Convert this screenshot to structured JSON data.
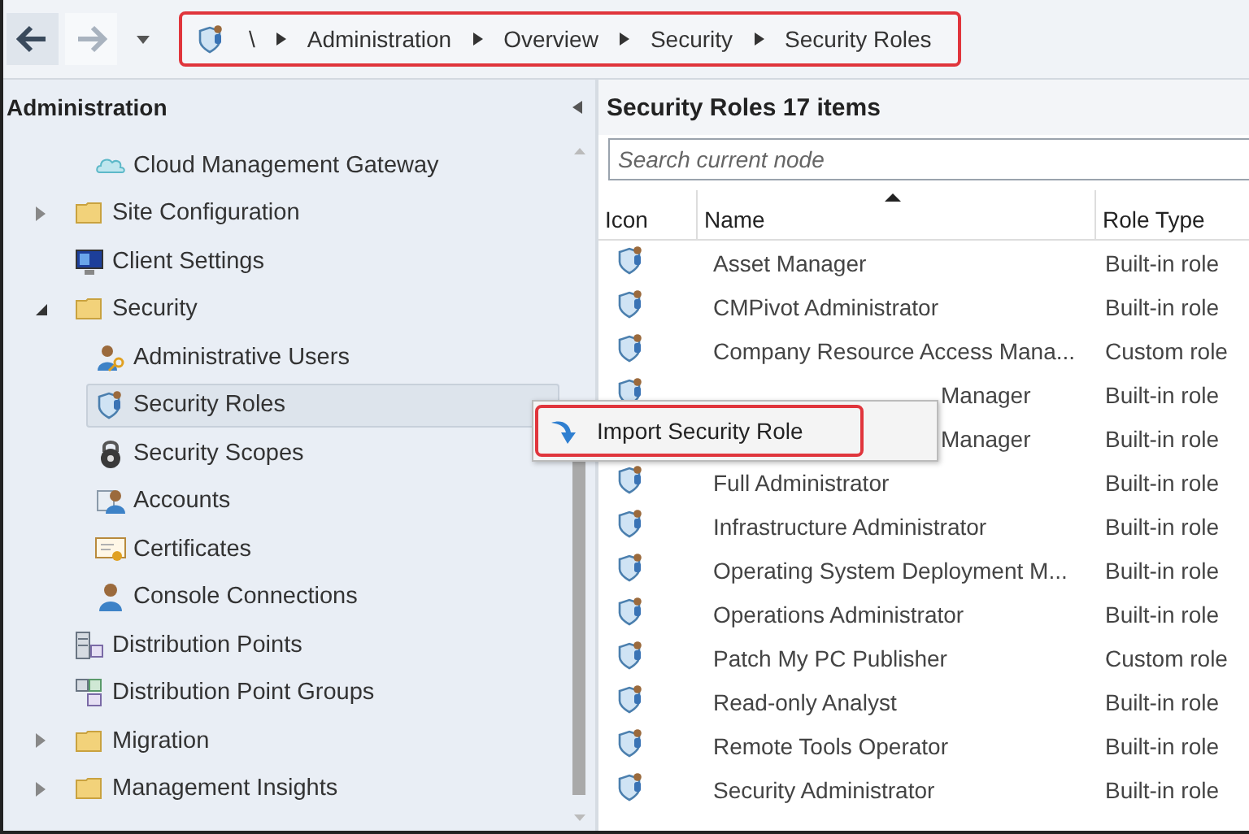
{
  "toolbar": {
    "breadcrumb": [
      {
        "label": "\\"
      },
      {
        "label": "Administration"
      },
      {
        "label": "Overview"
      },
      {
        "label": "Security"
      },
      {
        "label": "Security Roles"
      }
    ]
  },
  "navigation": {
    "title": "Administration",
    "partial_branch": [
      {
        "label": "Cloud Management Gateway",
        "kind": "cloud",
        "selected": false
      }
    ],
    "items": [
      {
        "label": "Site Configuration",
        "kind": "folder",
        "expanded": false,
        "selected": false
      },
      {
        "label": "Client Settings",
        "kind": "monitor",
        "selected": false
      },
      {
        "label": "Security",
        "kind": "folder",
        "expanded": true,
        "selected": false,
        "children": [
          {
            "label": "Administrative Users",
            "kind": "users",
            "selected": false
          },
          {
            "label": "Security Roles",
            "kind": "role",
            "selected": true
          },
          {
            "label": "Security Scopes",
            "kind": "lock",
            "selected": false
          },
          {
            "label": "Accounts",
            "kind": "account",
            "selected": false
          },
          {
            "label": "Certificates",
            "kind": "certificate",
            "selected": false
          },
          {
            "label": "Console Connections",
            "kind": "person",
            "selected": false
          }
        ]
      },
      {
        "label": "Distribution Points",
        "kind": "server",
        "selected": false
      },
      {
        "label": "Distribution Point Groups",
        "kind": "server-group",
        "selected": false
      },
      {
        "label": "Migration",
        "kind": "folder",
        "expanded": false,
        "selected": false
      },
      {
        "label": "Management Insights",
        "kind": "folder",
        "expanded": false,
        "selected": false
      }
    ]
  },
  "list": {
    "title": "Security Roles",
    "count": "17 items",
    "search": {
      "placeholder": "Search current node"
    },
    "columns": [
      "Icon",
      "Name",
      "Role Type"
    ],
    "rows": [
      {
        "name": "Asset Manager",
        "role_type": "Built-in role"
      },
      {
        "name": "CMPivot Administrator",
        "role_type": "Built-in role"
      },
      {
        "name": "Company Resource Access Mana...",
        "role_type": "Custom role"
      },
      {
        "name": "Manager",
        "role_type": "Built-in role",
        "partly_covered": true
      },
      {
        "name": "Manager",
        "role_type": "Built-in role",
        "partly_covered": true
      },
      {
        "name": "Full Administrator",
        "role_type": "Built-in role"
      },
      {
        "name": "Infrastructure Administrator",
        "role_type": "Built-in role"
      },
      {
        "name": "Operating System Deployment M...",
        "role_type": "Built-in role"
      },
      {
        "name": "Operations Administrator",
        "role_type": "Built-in role"
      },
      {
        "name": "Patch My PC Publisher",
        "role_type": "Custom role"
      },
      {
        "name": "Read-only Analyst",
        "role_type": "Built-in role"
      },
      {
        "name": "Remote Tools Operator",
        "role_type": "Built-in role"
      },
      {
        "name": "Security Administrator",
        "role_type": "Built-in role"
      }
    ]
  },
  "context_menu": {
    "items": [
      {
        "label": "Import Security Role"
      }
    ]
  }
}
